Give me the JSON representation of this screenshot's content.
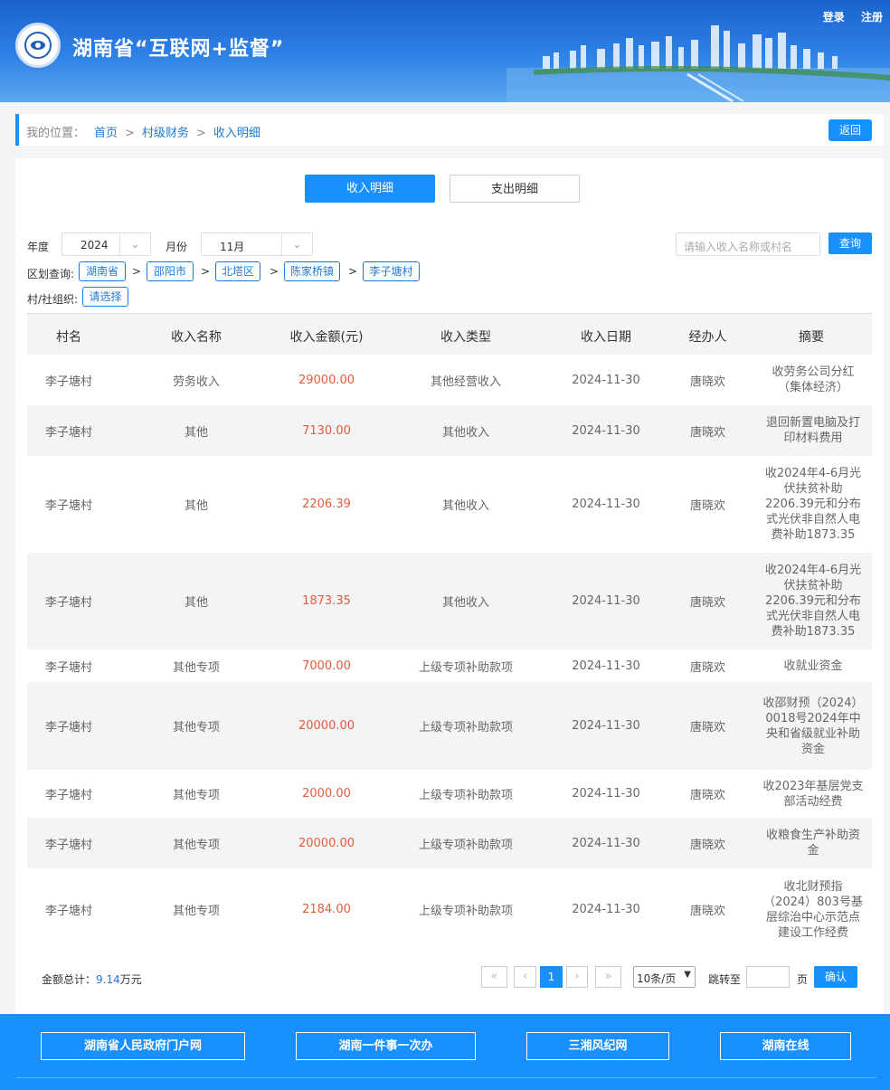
{
  "header": {
    "title": "湖南省“互联网+监督”",
    "login": "登录",
    "register": "注册"
  },
  "breadcrumb": {
    "label": "我的位置：",
    "items": [
      "首页",
      "村级财务",
      "收入明细"
    ],
    "separator": ">",
    "back": "返回"
  },
  "tabs": [
    "收入明细",
    "支出明细"
  ],
  "filters": {
    "year_label": "年度",
    "year_value": "2024",
    "month_label": "月份",
    "month_value": "11月",
    "search_placeholder": "请输入收入名称或村名",
    "search_button": "查询",
    "region_label": "区划查询:",
    "region_path": [
      "湖南省",
      "邵阳市",
      "北塔区",
      "陈家桥镇",
      "李子塘村"
    ],
    "org_label": "村/社组织:",
    "org_value": "请选择"
  },
  "table": {
    "headers": [
      "村名",
      "收入名称",
      "收入金额(元)",
      "收入类型",
      "收入日期",
      "经办人",
      "摘要"
    ],
    "rows": [
      [
        "李子塘村",
        "劳务收入",
        "29000.00",
        "其他经营收入",
        "2024-11-30",
        "唐晓欢",
        "收劳务公司分红（集体经济）"
      ],
      [
        "李子塘村",
        "其他",
        "7130.00",
        "其他收入",
        "2024-11-30",
        "唐晓欢",
        "退回新置电脑及打印材料费用"
      ],
      [
        "李子塘村",
        "其他",
        "2206.39",
        "其他收入",
        "2024-11-30",
        "唐晓欢",
        "收2024年4-6月光伏扶贫补助2206.39元和分布式光伏非自然人电费补助1873.35"
      ],
      [
        "李子塘村",
        "其他",
        "1873.35",
        "其他收入",
        "2024-11-30",
        "唐晓欢",
        "收2024年4-6月光伏扶贫补助2206.39元和分布式光伏非自然人电费补助1873.35"
      ],
      [
        "李子塘村",
        "其他专项",
        "7000.00",
        "上级专项补助款项",
        "2024-11-30",
        "唐晓欢",
        "收就业资金"
      ],
      [
        "李子塘村",
        "其他专项",
        "20000.00",
        "上级专项补助款项",
        "2024-11-30",
        "唐晓欢",
        "收邵财预（2024）0018号2024年中央和省级就业补助资金"
      ],
      [
        "李子塘村",
        "其他专项",
        "2000.00",
        "上级专项补助款项",
        "2024-11-30",
        "唐晓欢",
        "收2023年基层党支部活动经费"
      ],
      [
        "李子塘村",
        "其他专项",
        "20000.00",
        "上级专项补助款项",
        "2024-11-30",
        "唐晓欢",
        "收粮食生产补助资金"
      ],
      [
        "李子塘村",
        "其他专项",
        "2184.00",
        "上级专项补助款项",
        "2024-11-30",
        "唐晓欢",
        "收北财预指（2024）803号基层综治中心示范点建设工作经费"
      ]
    ]
  },
  "summary": {
    "total_label": "金额总计：",
    "total_value": "9.14",
    "total_unit": "万元"
  },
  "pagination": {
    "first": "«",
    "prev": "‹",
    "current": "1",
    "next": "›",
    "last": "»",
    "page_size": "10条/页",
    "jump_label": "跳转至",
    "page_unit": "页",
    "confirm": "确认"
  },
  "footer_links": [
    "湖南省人民政府门户网",
    "湖南一件事一次办",
    "三湘风纪网",
    "湖南在线"
  ],
  "colors": {
    "primary": "#1890ff",
    "amount": "#e55a3c",
    "link": "#1f7ad6"
  }
}
